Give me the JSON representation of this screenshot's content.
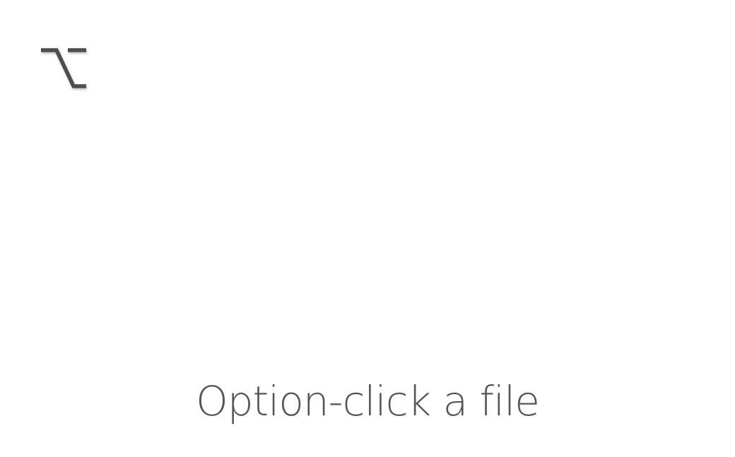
{
  "slide": {
    "icon": "option-key-icon",
    "caption": "Option-click a file",
    "colors": {
      "background": "#ffffff",
      "text": "#555555",
      "icon": "#4d4d4d"
    }
  }
}
